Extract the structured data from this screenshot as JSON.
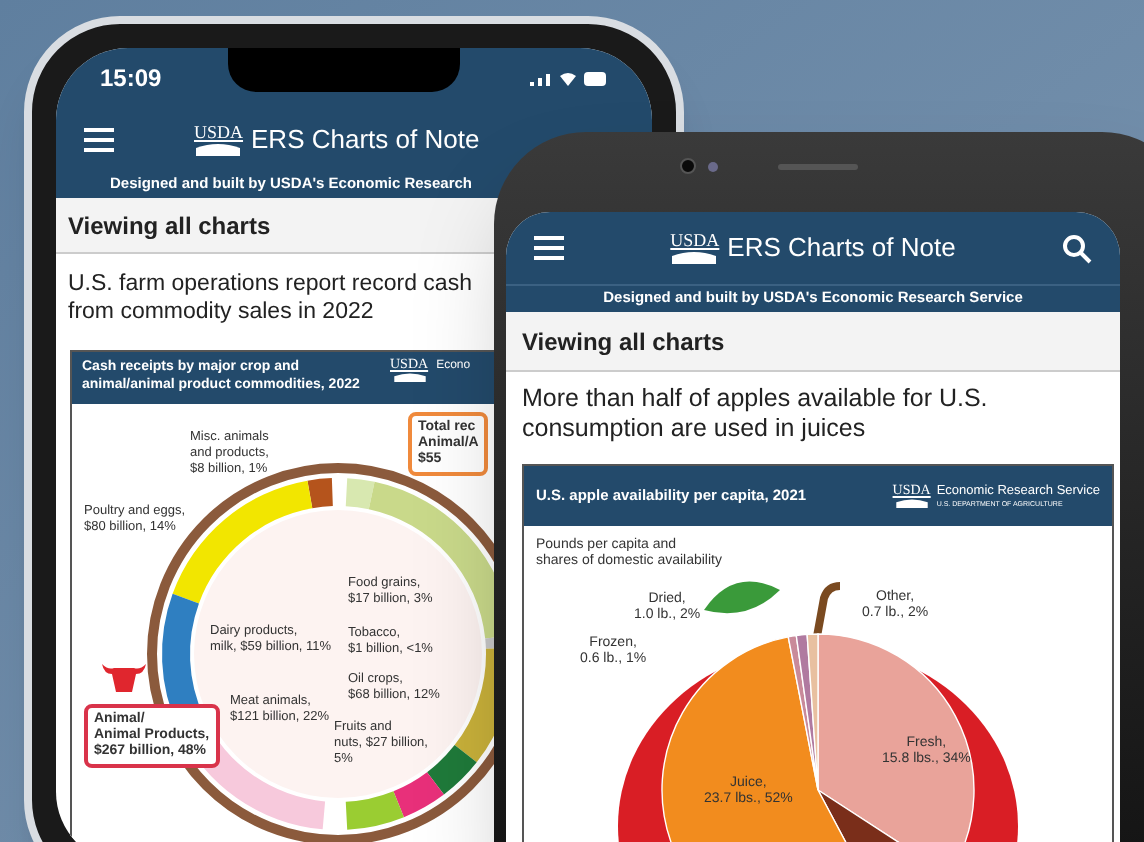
{
  "background_phone": {
    "status_bar": {
      "time": "15:09"
    },
    "app_bar": {
      "logo": "USDA",
      "title": "ERS Charts of Note"
    },
    "tagline": "Designed and built by USDA's Economic Research",
    "section_heading": "Viewing all charts",
    "headline_lines": [
      "U.S. farm operations report record cash",
      "from commodity sales in 2022"
    ],
    "chart_header": {
      "title": "Cash receipts by major crop and animal/animal product commodities, 2022",
      "logo": "USDA",
      "agency": "Econo"
    },
    "infographic_labels": [
      "Misc. animals\nand products,\n$8 billion, 1%",
      "Poultry and eggs,\n$80 billion, 14%",
      "Dairy products,\nmilk, $59 billion, 11%",
      "Meat animals,\n$121 billion, 22%",
      "Food grains,\n$17 billion, 3%",
      "Tobacco,\n$1 billion, <1%",
      "Oil crops,\n$68 billion, 12%",
      "Fruits and\nnuts, $27 billion,\n5%"
    ],
    "callouts": [
      "Animal/\nAnimal Products,\n$267 billion, 48%",
      "Total rec\nAnimal/A\n$55"
    ]
  },
  "foreground_phone": {
    "app_bar": {
      "logo": "USDA",
      "title": "ERS Charts of Note"
    },
    "tagline": "Designed and built by USDA's Economic Research Service",
    "section_heading": "Viewing all charts",
    "headline": "More than half of apples available for U.S. consumption are used in juices",
    "chart_header": {
      "title": "U.S. apple availability per capita, 2021",
      "logo": "USDA",
      "agency": "Economic Research Service",
      "department": "U.S. DEPARTMENT OF AGRICULTURE"
    },
    "infographic_subtitle": "Pounds per capita and\nshares of domestic availability",
    "infographic_labels": [
      "Fresh,\n15.8 lbs., 34%",
      "Juice,\n23.7 lbs., 52%",
      "Frozen,\n0.6 lb., 1%",
      "Dried,\n1.0 lb., 2%",
      "Other,\n0.7 lb., 2%"
    ]
  }
}
